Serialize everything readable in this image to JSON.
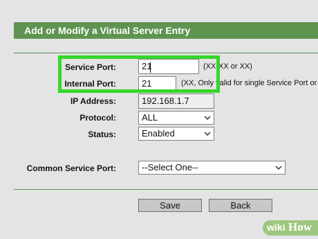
{
  "header": {
    "title": "Add or Modify a Virtual Server Entry"
  },
  "form": {
    "service_port": {
      "label": "Service Port:",
      "value": "21",
      "hint": "(XX-XX or XX)"
    },
    "internal_port": {
      "label": "Internal Port:",
      "value": "21",
      "hint": "(XX, Only valid for single Service Port or with"
    },
    "ip_address": {
      "label": "IP Address:",
      "value": "192.168.1.7"
    },
    "protocol": {
      "label": "Protocol:",
      "value": "ALL"
    },
    "status": {
      "label": "Status:",
      "value": "Enabled"
    },
    "common_service_port": {
      "label": "Common Service Port:",
      "value": "--Select One--"
    }
  },
  "buttons": {
    "save": "Save",
    "back": "Back"
  },
  "watermark": {
    "wiki": "wiki",
    "how": "How"
  },
  "colors": {
    "header": "#5f9450",
    "highlight": "#35d62c",
    "background": "#e4e4e4"
  }
}
